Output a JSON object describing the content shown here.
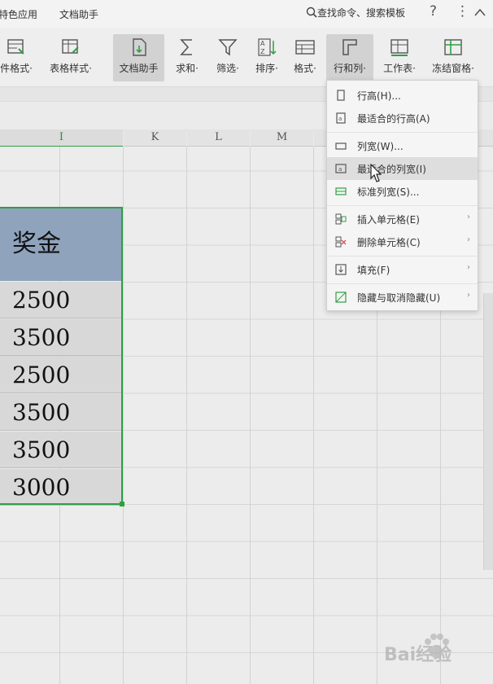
{
  "topbar": {
    "tab_special_apps": "特色应用",
    "tab_doc_assistant": "文档助手",
    "search_label": "查找命令、搜索模板",
    "help_icon": "question-icon",
    "more_icon": "vertical-ellipsis-icon",
    "collapse_icon": "chevron-up-icon"
  },
  "ribbon": {
    "items": [
      {
        "label": "件格式·",
        "icon": "conditional-format-icon"
      },
      {
        "label": "表格样式·",
        "icon": "table-style-icon"
      },
      {
        "label": "文档助手",
        "icon": "doc-assistant-icon"
      },
      {
        "label": "求和·",
        "icon": "sigma-icon"
      },
      {
        "label": "筛选·",
        "icon": "filter-funnel-icon"
      },
      {
        "label": "排序·",
        "icon": "sort-az-icon"
      },
      {
        "label": "格式·",
        "icon": "format-icon"
      },
      {
        "label": "行和列·",
        "icon": "rows-columns-icon"
      },
      {
        "label": "工作表·",
        "icon": "worksheet-icon"
      },
      {
        "label": "冻结窗格·",
        "icon": "freeze-panes-icon"
      }
    ]
  },
  "sheet": {
    "columns": [
      "I",
      "K",
      "L",
      "M"
    ],
    "header_cell": "奖金",
    "values": [
      "2500",
      "3500",
      "2500",
      "3500",
      "3500",
      "3000"
    ],
    "header_color": "#8fa3bd",
    "selection_color": "#2ea043"
  },
  "menu": {
    "items": [
      {
        "label": "行高(H)...",
        "icon": "row-height-icon",
        "submenu": false
      },
      {
        "label": "最适合的行高(A)",
        "icon": "best-fit-row-icon",
        "submenu": false
      },
      {
        "label": "列宽(W)...",
        "icon": "column-width-icon",
        "submenu": false
      },
      {
        "label": "最适合的列宽(I)",
        "icon": "best-fit-column-icon",
        "submenu": false
      },
      {
        "label": "标准列宽(S)...",
        "icon": "standard-width-icon",
        "submenu": false
      },
      {
        "label": "插入单元格(E)",
        "icon": "insert-cell-icon",
        "submenu": true
      },
      {
        "label": "删除单元格(C)",
        "icon": "delete-cell-icon",
        "submenu": true
      },
      {
        "label": "填充(F)",
        "icon": "fill-icon",
        "submenu": true
      },
      {
        "label": "隐藏与取消隐藏(U)",
        "icon": "hide-unhide-icon",
        "submenu": true
      }
    ],
    "submenu_arrow": "›",
    "hover_index": 3
  },
  "watermark": {
    "text": "Bai经验"
  }
}
